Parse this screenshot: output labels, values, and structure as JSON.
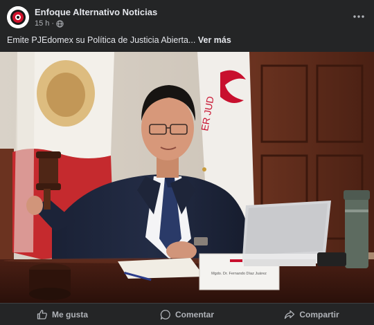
{
  "post": {
    "page_name": "Enfoque Alternativo Noticias",
    "time": "15 h",
    "separator": "·",
    "audience_icon": "globe-icon",
    "more_icon": "more-horizontal-icon",
    "caption": "Emite PJEdomex su Política de Justicia Abierta...",
    "see_more": "Ver más",
    "photo_nameplate": "Mgdo. Dr. Fernando Díaz Juárez"
  },
  "actions": [
    {
      "label": "Me gusta",
      "icon": "like-icon"
    },
    {
      "label": "Comentar",
      "icon": "comment-icon"
    },
    {
      "label": "Compartir",
      "icon": "share-icon"
    }
  ],
  "colors": {
    "background": "#242526",
    "text_primary": "#e4e6eb",
    "text_secondary": "#b0b3b8",
    "brand_red": "#c8102e"
  }
}
